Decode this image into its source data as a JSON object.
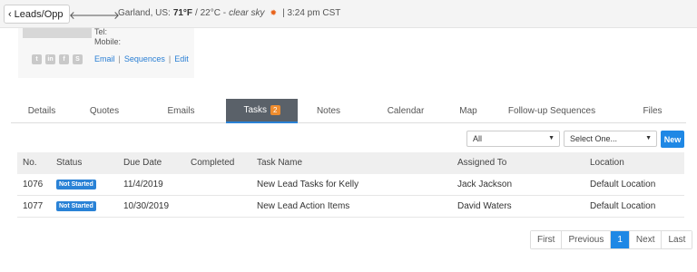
{
  "topbar": {
    "back_label": "Leads/Opp",
    "location": "Garland, US:",
    "temp_f": "71°F",
    "temp_c": "/ 22°C -",
    "condition": "clear sky",
    "time": "| 3:24 pm CST"
  },
  "card": {
    "tel_label": "Tel:",
    "mobile_label": "Mobile:",
    "social_icons": [
      "twitter-icon",
      "linkedin-icon",
      "facebook-icon",
      "skype-icon"
    ],
    "links": {
      "email": "Email",
      "sequences": "Sequences",
      "edit": "Edit"
    }
  },
  "tabs": [
    {
      "label": "Details"
    },
    {
      "label": "Quotes"
    },
    {
      "label": "Emails"
    },
    {
      "label": "Tasks",
      "badge": "2",
      "active": true
    },
    {
      "label": "Notes"
    },
    {
      "label": "Calendar"
    },
    {
      "label": "Map"
    },
    {
      "label": "Follow-up Sequences"
    },
    {
      "label": "Files"
    }
  ],
  "filters": {
    "status_value": "All",
    "select_value": "Select One...",
    "new_label": "New"
  },
  "table": {
    "headers": [
      "No.",
      "Status",
      "Due Date",
      "Completed",
      "Task Name",
      "Assigned To",
      "Location"
    ],
    "rows": [
      [
        "1076",
        "Not Started",
        "11/4/2019",
        "",
        "New Lead Tasks for Kelly",
        "Jack Jackson",
        "Default Location"
      ],
      [
        "1077",
        "Not Started",
        "10/30/2019",
        "",
        "New Lead Action Items",
        "David Waters",
        "Default Location"
      ]
    ]
  },
  "pagination": {
    "first": "First",
    "previous": "Previous",
    "current": "1",
    "next": "Next",
    "last": "Last"
  },
  "colors": {
    "accent": "#1f88e5",
    "active_tab_bg": "#5a6169",
    "badge": "#ef8c2e",
    "status_badge": "#2a82d6",
    "sun": "#e8621a"
  }
}
